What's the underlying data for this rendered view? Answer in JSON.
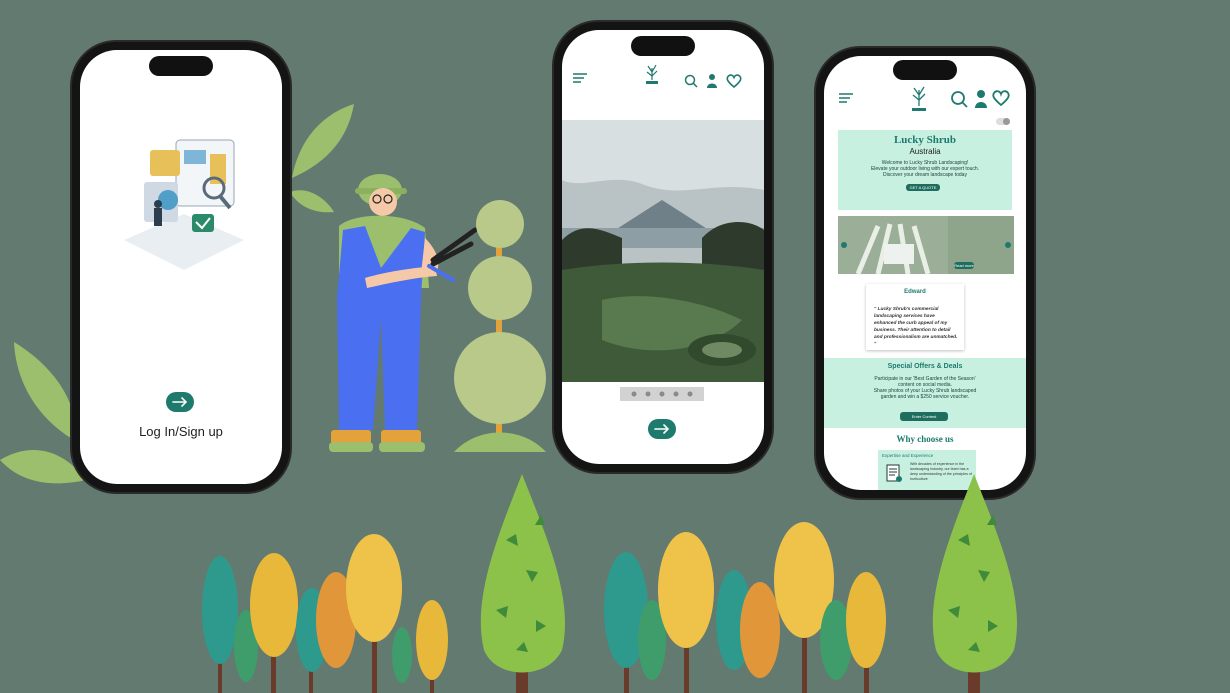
{
  "phone1": {
    "login_label": "Log In/Sign up",
    "next_icon": "arrow-right-icon"
  },
  "phone2": {
    "menu_icon": "hamburger-icon",
    "logo_icon": "lucky-shrub-logo",
    "search_icon": "search-icon",
    "account_icon": "user-icon",
    "favorites_icon": "heart-icon",
    "next_icon": "arrow-right-icon"
  },
  "phone3": {
    "brand_title": "Lucky Shrub",
    "brand_subtitle": "Australia",
    "welcome_lines": [
      "Welcome to Lucky Shrub Landscaping!",
      "Elevate your outdoor living with our expert touch.",
      "Discover your dream landscape today"
    ],
    "quote_button": "GET A QUOTE",
    "carousel_button": "Read more",
    "testimonial_name": "Edward",
    "testimonial_quote": "\" Lucky Shrub's commercial landscaping services have enhanced the curb appeal of my business. Their attention to detail and professionalism are unmatched. \"",
    "offers_title": "Special Offers & Deals",
    "offers_lines": [
      "Participate in our 'Best Garden of the Season'",
      "content on social media.",
      "Share photos of your Lucky Shrub landscaped",
      "garden and win a $250 service voucher."
    ],
    "offers_button": "Enter Contest",
    "why_title": "Why choose us",
    "card_title": "Expertise and Experience",
    "card_text": "With decades of experience in the landscaping industry, our team has a deep understanding of the principles of horticulture"
  },
  "colors": {
    "background": "#637a70",
    "accent": "#1d7a6d",
    "mint": "#c8f0e1"
  }
}
